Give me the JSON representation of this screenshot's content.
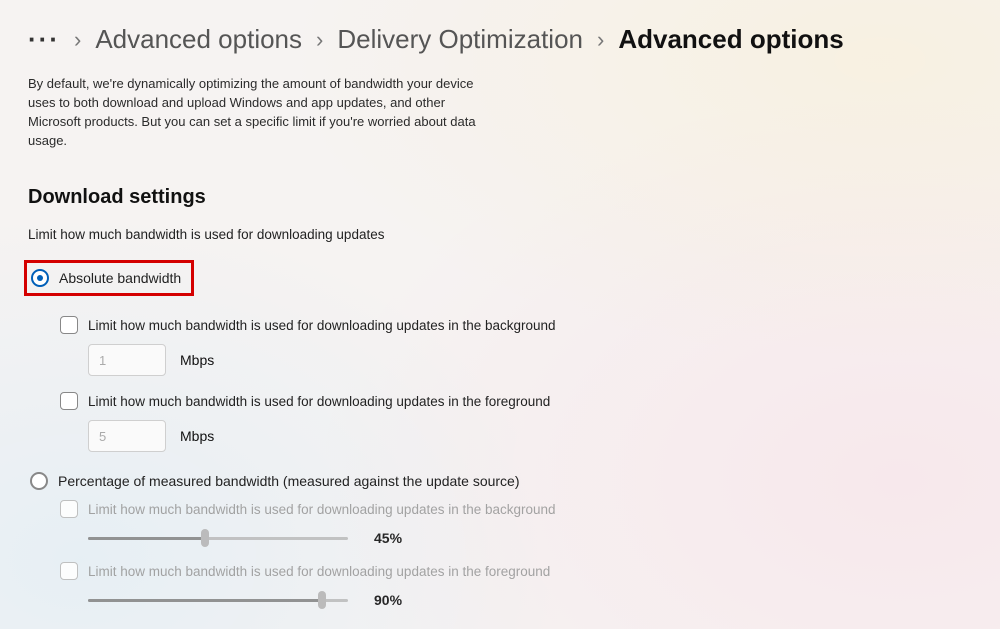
{
  "breadcrumb": {
    "more": "···",
    "l1": "Advanced options",
    "l2": "Delivery Optimization",
    "current": "Advanced options"
  },
  "intro": "By default, we're dynamically optimizing the amount of bandwidth your device uses to both download and upload Windows and app updates, and other Microsoft products. But you can set a specific limit if you're worried about data usage.",
  "section_title": "Download settings",
  "sub": "Limit how much bandwidth is used for downloading updates",
  "radio_abs": "Absolute bandwidth",
  "radio_pct": "Percentage of measured bandwidth (measured against the update source)",
  "abs_bg_label": "Limit how much bandwidth is used for downloading updates in the background",
  "abs_fg_label": "Limit how much bandwidth is used for downloading updates in the foreground",
  "abs_bg_value": "1",
  "abs_fg_value": "5",
  "unit": "Mbps",
  "pct_bg_label": "Limit how much bandwidth is used for downloading updates in the background",
  "pct_fg_label": "Limit how much bandwidth is used for downloading updates in the foreground",
  "pct_bg_val_label": "45%",
  "pct_fg_val_label": "90%",
  "pct_bg_percent": 45,
  "pct_fg_percent": 90
}
